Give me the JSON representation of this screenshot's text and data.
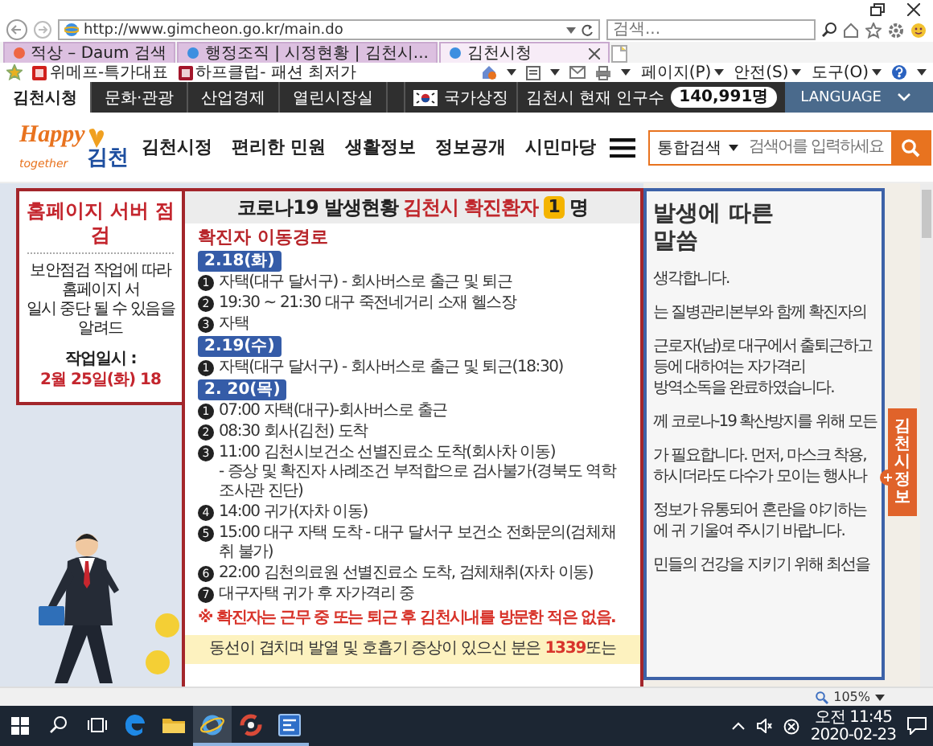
{
  "browser": {
    "address": "http://www.gimcheon.go.kr/main.do",
    "search_placeholder": "검색...",
    "tabs": [
      {
        "label": "적상 – Daum 검색",
        "selected": false
      },
      {
        "label": "행정조직 | 시정현황 | 김천시...",
        "selected": false
      },
      {
        "label": "김천시청",
        "selected": true
      }
    ],
    "favorites": [
      "위메프-특가대표",
      "하프클럽- 패션 최저가"
    ],
    "commands": [
      "페이지(P)",
      "안전(S)",
      "도구(O)"
    ]
  },
  "site_nav": {
    "items": [
      {
        "label": "김천시청",
        "selected": true
      },
      {
        "label": "문화·관광",
        "selected": false
      },
      {
        "label": "산업경제",
        "selected": false
      },
      {
        "label": "열린시장실",
        "selected": false
      }
    ],
    "symbol": "국가상징",
    "population_label": "김천시 현재 인구수",
    "population": "140,991명",
    "language": "LANGUAGE"
  },
  "header": {
    "logo": {
      "word": "Happy",
      "sub": "together",
      "city": "김천"
    },
    "menu": [
      "김천시정",
      "편리한 민원",
      "생활정보",
      "정보공개",
      "시민마당"
    ],
    "search": {
      "scope": "통합검색",
      "placeholder": "검색어를 입력하세요"
    }
  },
  "notice": {
    "title": "홈페이지 서버 점검",
    "lines": [
      "보안점검 작업에 따라 홈페이지 서",
      "일시 중단 될 수 있음을 알려드"
    ],
    "date_label": "작업일시 :",
    "date": "2월 25일(화) 18"
  },
  "covid_popup": {
    "title": "코로나19 발생현황",
    "highlight": "김천시 확진환자",
    "count": "1",
    "unit": "명",
    "subtitle": "확진자 이동경로",
    "days": [
      {
        "date": "2.18(화)",
        "steps": [
          {
            "num": "1",
            "text": "자택(대구 달서구) - 회사버스로 출근 및 퇴근"
          },
          {
            "num": "2",
            "text": "19:30 ~ 21:30 대구 죽전네거리 소재 헬스장"
          },
          {
            "num": "3",
            "text": "자택"
          }
        ]
      },
      {
        "date": "2.19(수)",
        "steps": [
          {
            "num": "1",
            "text": "자택(대구 달서구) - 회사버스로 출근 및 퇴근(18:30)"
          }
        ]
      },
      {
        "date": "2. 20(목)",
        "steps": [
          {
            "num": "1",
            "text": "07:00 자택(대구)-회사버스로 출근"
          },
          {
            "num": "2",
            "text": "08:30 회사(김천) 도착"
          },
          {
            "num": "3",
            "text": "11:00 김천시보건소 선별진료소 도착(회사차 이동)",
            "note": "- 증상 및 확진자 사례조건 부적합으로 검사불가(경북도 역학조사관 진단)"
          },
          {
            "num": "4",
            "text": "14:00 귀가(자차 이동)"
          },
          {
            "num": "5",
            "text": "15:00 대구 자택 도착 - 대구 달서구 보건소 전화문의(검체채취 불가)"
          },
          {
            "num": "6",
            "text": "22:00 김천의료원 선별진료소 도착, 검체채취(자차 이동)"
          },
          {
            "num": "7",
            "text": "대구자택 귀가 후 자가격리 중"
          }
        ]
      }
    ],
    "warning": "※ 확진자는 근무 중 또는 퇴근 후 김천시내를 방문한 적은 없음.",
    "contact": "동선이 겹치며 발열 및 호흡기 증상이 있으신 분은 **1339**또는"
  },
  "message_panel": {
    "title_lines": [
      "발생에 따른",
      "말씀"
    ],
    "paragraphs": [
      [
        "생각합니다."
      ],
      [
        "는 질병관리본부와 함께 확진자의"
      ],
      [
        "근로자(남)로 대구에서 출퇴근하고",
        "등에 대하여는 자가격리",
        "방역소독을 완료하였습니다."
      ],
      [
        "께 코로나-19 확산방지를 위해 모든"
      ],
      [
        "가 필요합니다. 먼저, 마스크 착용,",
        "하시더라도 다수가 모이는 행사나"
      ],
      [
        "정보가 유통되어 혼란을 야기하는",
        "에 귀 기울여 주시기 바랍니다."
      ],
      [
        "민들의 건강을 지키기 위해 최선을"
      ]
    ]
  },
  "side_tab": "김천시 정보",
  "status_bar": {
    "zoom": "105%"
  },
  "taskbar": {
    "apps": [
      {
        "kind": "edge",
        "selected": false,
        "running": false
      },
      {
        "kind": "folder",
        "selected": false,
        "running": false
      },
      {
        "kind": "ie",
        "selected": true,
        "running": true
      },
      {
        "kind": "chrome",
        "selected": false,
        "running": true
      },
      {
        "kind": "app",
        "selected": false,
        "running": true
      }
    ],
    "time": "오전 11:45",
    "date": "2020-02-23"
  }
}
